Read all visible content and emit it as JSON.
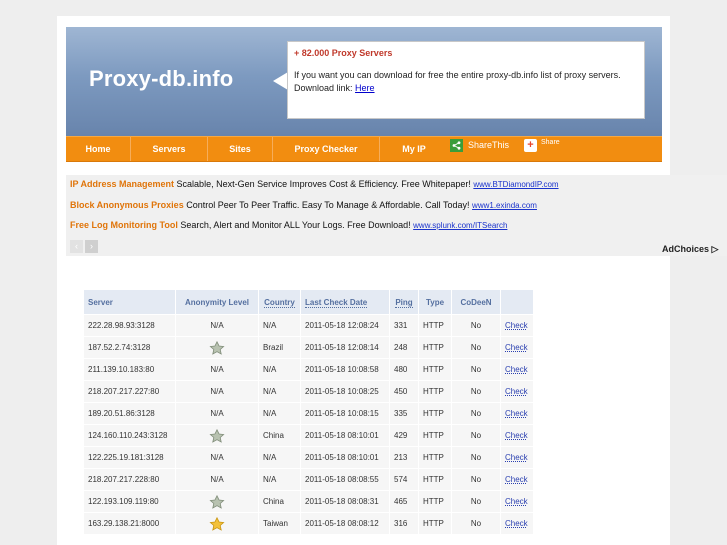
{
  "logo": "Proxy-db.info",
  "promo": {
    "title": "+ 82.000 Proxy Servers",
    "text": "If you want you can download for free the entire proxy-db.info list of proxy servers. Download link: ",
    "link": "Here"
  },
  "nav": {
    "items": [
      "Home",
      "Servers",
      "Sites",
      "Proxy Checker",
      "My IP"
    ],
    "share_this": "ShareThis",
    "share": "Share"
  },
  "ads": [
    {
      "title": "IP Address Management",
      "text": " Scalable, Next-Gen Service Improves Cost & Efficiency. Free Whitepaper! ",
      "url": "www.BTDiamondIP.com"
    },
    {
      "title": "Block Anonymous Proxies",
      "text": " Control Peer To Peer Traffic. Easy To Manage & Affordable. Call Today! ",
      "url": "www1.exinda.com"
    },
    {
      "title": "Free Log Monitoring Tool",
      "text": " Search, Alert and Monitor ALL Your Logs. Free Download! ",
      "url": "www.splunk.com/ITSearch"
    }
  ],
  "adchoices": "AdChoices",
  "table": {
    "headers": [
      "Server",
      "Anonymity Level",
      "Country",
      "Last Check Date",
      "Ping",
      "Type",
      "CoDeeN",
      ""
    ],
    "rows": [
      {
        "server": "222.28.98.93:3128",
        "anon": "N/A",
        "country": "N/A",
        "date": "2011-05-18 12:08:24",
        "ping": "331",
        "type": "HTTP",
        "codeen": "No",
        "check": "Check"
      },
      {
        "server": "187.52.2.74:3128",
        "anon": "star-grey",
        "country": "Brazil",
        "date": "2011-05-18 12:08:14",
        "ping": "248",
        "type": "HTTP",
        "codeen": "No",
        "check": "Check"
      },
      {
        "server": "211.139.10.183:80",
        "anon": "N/A",
        "country": "N/A",
        "date": "2011-05-18 10:08:58",
        "ping": "480",
        "type": "HTTP",
        "codeen": "No",
        "check": "Check"
      },
      {
        "server": "218.207.217.227:80",
        "anon": "N/A",
        "country": "N/A",
        "date": "2011-05-18 10:08:25",
        "ping": "450",
        "type": "HTTP",
        "codeen": "No",
        "check": "Check"
      },
      {
        "server": "189.20.51.86:3128",
        "anon": "N/A",
        "country": "N/A",
        "date": "2011-05-18 10:08:15",
        "ping": "335",
        "type": "HTTP",
        "codeen": "No",
        "check": "Check"
      },
      {
        "server": "124.160.110.243:3128",
        "anon": "star-grey",
        "country": "China",
        "date": "2011-05-18 08:10:01",
        "ping": "429",
        "type": "HTTP",
        "codeen": "No",
        "check": "Check"
      },
      {
        "server": "122.225.19.181:3128",
        "anon": "N/A",
        "country": "N/A",
        "date": "2011-05-18 08:10:01",
        "ping": "213",
        "type": "HTTP",
        "codeen": "No",
        "check": "Check"
      },
      {
        "server": "218.207.217.228:80",
        "anon": "N/A",
        "country": "N/A",
        "date": "2011-05-18 08:08:55",
        "ping": "574",
        "type": "HTTP",
        "codeen": "No",
        "check": "Check"
      },
      {
        "server": "122.193.109.119:80",
        "anon": "star-grey",
        "country": "China",
        "date": "2011-05-18 08:08:31",
        "ping": "465",
        "type": "HTTP",
        "codeen": "No",
        "check": "Check"
      },
      {
        "server": "163.29.138.21:8000",
        "anon": "star-gold",
        "country": "Taiwan",
        "date": "2011-05-18 08:08:12",
        "ping": "316",
        "type": "HTTP",
        "codeen": "No",
        "check": "Check"
      }
    ]
  },
  "colors": {
    "nav": "#f28d10",
    "ad_title": "#e0750a",
    "header_blue": "#7d9ac0",
    "promo_title": "#c0392b"
  }
}
